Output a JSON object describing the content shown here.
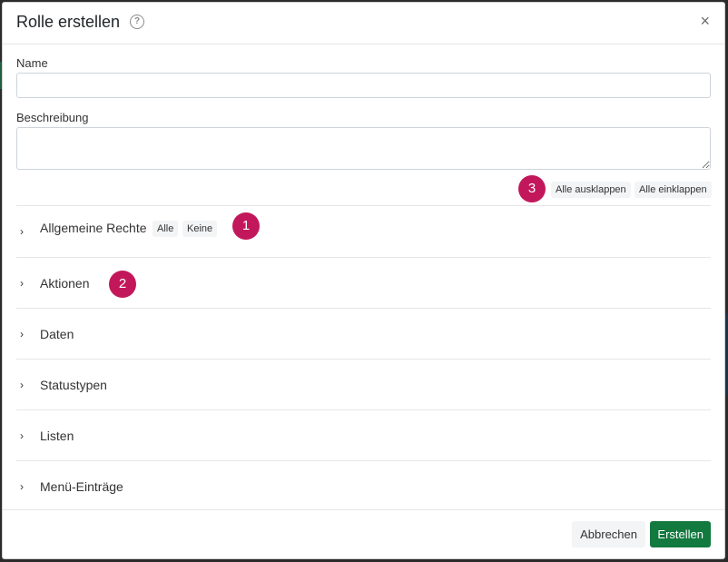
{
  "dialog": {
    "title": "Rolle erstellen",
    "close_symbol": "×",
    "help_symbol": "?"
  },
  "form": {
    "name_label": "Name",
    "name_value": "",
    "description_label": "Beschreibung",
    "description_value": ""
  },
  "expand_controls": {
    "expand_all": "Alle ausklappen",
    "collapse_all": "Alle einklappen"
  },
  "sections": [
    {
      "label": "Allgemeine Rechte",
      "buttons": [
        "Alle",
        "Keine"
      ]
    },
    {
      "label": "Aktionen"
    },
    {
      "label": "Daten"
    },
    {
      "label": "Statustypen"
    },
    {
      "label": "Listen"
    },
    {
      "label": "Menü-Einträge"
    }
  ],
  "annotations": [
    "1",
    "2",
    "3"
  ],
  "footer": {
    "cancel": "Abbrechen",
    "create": "Erstellen"
  },
  "colors": {
    "primary_button": "#12793f",
    "annotation_badge": "#c2185b"
  },
  "icons": {
    "chevron": "chevron-right-icon",
    "help": "help-circle-icon",
    "close": "close-icon"
  }
}
